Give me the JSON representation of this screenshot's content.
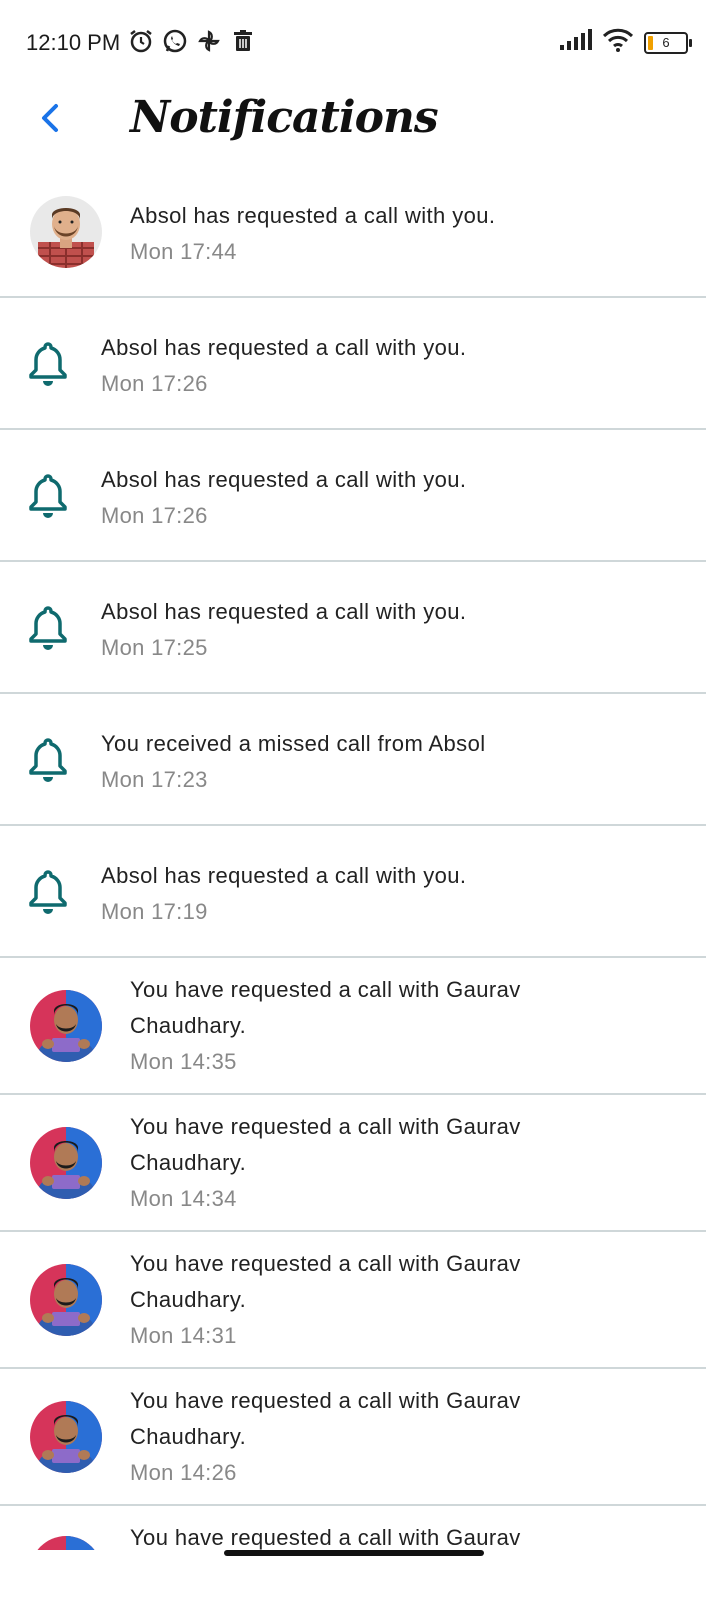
{
  "status_bar": {
    "time": "12:10 PM",
    "battery": "6",
    "icons": [
      "alarm-icon",
      "whatsapp-icon",
      "pinwheel-icon",
      "trash-icon",
      "signal-icon",
      "wifi-icon",
      "battery-icon"
    ]
  },
  "header": {
    "title": "Notifications",
    "back_icon": "chevron-left-icon"
  },
  "colors": {
    "accent": "#1a73e8",
    "bell": "#0f6a6e",
    "divider": "#cfd7d9",
    "time": "#888888"
  },
  "notifications": [
    {
      "type": "avatar",
      "avatar": "absol",
      "message": "Absol has requested a call with you.",
      "time": "Mon 17:44"
    },
    {
      "type": "bell",
      "message": "Absol has requested a call with you.",
      "time": "Mon 17:26"
    },
    {
      "type": "bell",
      "message": "Absol has requested a call with you.",
      "time": "Mon 17:26"
    },
    {
      "type": "bell",
      "message": "Absol has requested a call with you.",
      "time": "Mon 17:25"
    },
    {
      "type": "bell",
      "message": "You received a missed call from Absol",
      "time": "Mon 17:23"
    },
    {
      "type": "bell",
      "message": "Absol has requested a call with you.",
      "time": "Mon 17:19"
    },
    {
      "type": "avatar",
      "avatar": "gaurav",
      "message": "You have requested a call with Gaurav Chaudhary.",
      "time": "Mon 14:35"
    },
    {
      "type": "avatar",
      "avatar": "gaurav",
      "message": "You have requested a call with Gaurav Chaudhary.",
      "time": "Mon 14:34"
    },
    {
      "type": "avatar",
      "avatar": "gaurav",
      "message": "You have requested a call with Gaurav Chaudhary.",
      "time": "Mon 14:31"
    },
    {
      "type": "avatar",
      "avatar": "gaurav",
      "message": "You have requested a call with Gaurav Chaudhary.",
      "time": "Mon 14:26"
    },
    {
      "type": "avatar",
      "avatar": "gaurav",
      "message": "You have requested a call with Gaurav",
      "time": ""
    }
  ]
}
